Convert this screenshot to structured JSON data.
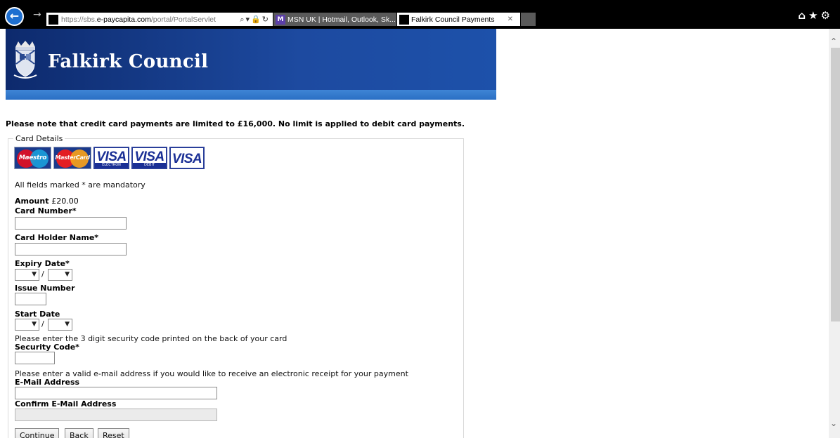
{
  "browser": {
    "url_prefix": "https://sbs.",
    "url_domain": "e-paycapita.com",
    "url_path": "/portal/PortalServlet",
    "tabs": [
      {
        "label": "MSN UK | Hotmail, Outlook, Sk..."
      },
      {
        "label": "Falkirk Council Payments"
      }
    ]
  },
  "header": {
    "org_name": "Falkirk Council",
    "brand_color": "#1d4aa0"
  },
  "notice": "Please note that credit card payments are limited to £16,000. No limit is applied to debit card payments.",
  "form": {
    "legend": "Card Details",
    "card_logos": [
      {
        "name": "Maestro",
        "text": "Maestro"
      },
      {
        "name": "MasterCard",
        "text": "MasterCard"
      },
      {
        "name": "Visa Electron",
        "text": "VISA",
        "sub": "ELECTRON"
      },
      {
        "name": "Visa Debit",
        "text": "VISA",
        "sub": "DEBIT"
      },
      {
        "name": "Visa",
        "text": "VISA"
      }
    ],
    "mandatory_note": "All fields marked * are mandatory",
    "amount_label": "Amount",
    "amount_value": "£20.00",
    "card_number_label": "Card Number*",
    "card_number_value": "",
    "card_holder_label": "Card Holder Name*",
    "card_holder_value": "",
    "expiry_label": "Expiry Date*",
    "expiry_month": "",
    "expiry_year": "",
    "issue_label": "Issue Number",
    "issue_value": "",
    "start_label": "Start Date",
    "start_month": "",
    "start_year": "",
    "security_hint": "Please enter the 3 digit security code printed on the back of your card",
    "security_label": "Security Code*",
    "security_value": "",
    "email_hint": "Please enter a valid e-mail address if you would like to receive an electronic receipt for your payment",
    "email_label": "E-Mail Address",
    "email_value": "",
    "confirm_email_label": "Confirm E-Mail Address",
    "confirm_email_value": "",
    "separator": "/",
    "buttons": {
      "continue": "Continue",
      "back": "Back",
      "reset": "Reset"
    }
  }
}
